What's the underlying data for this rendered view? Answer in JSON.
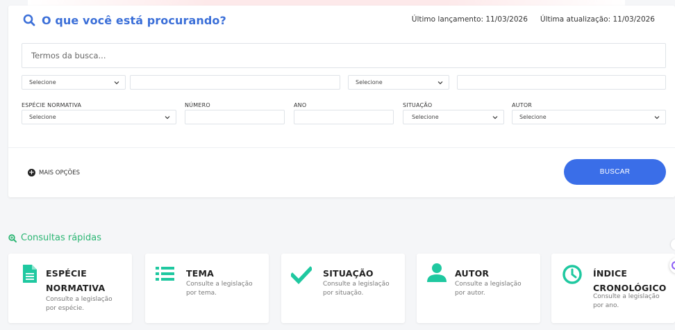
{
  "search": {
    "heading": "O que você está procurando?",
    "last_release": "Último lançamento: 11/03/2026",
    "last_update": "Última atualização: 11/03/2026",
    "terms_placeholder": "Termos da busca...",
    "row1": {
      "select1": "Selecione",
      "input1": "",
      "select2": "Selecione",
      "input2": ""
    },
    "labels": {
      "especie": "ESPÉCIE NORMATIVA",
      "numero": "NÚMERO",
      "ano": "ANO",
      "situacao": "SITUAÇÃO",
      "autor": "AUTOR"
    },
    "row2": {
      "especie_value": "Selecione",
      "numero_value": "",
      "ano_value": "",
      "situacao_value": "Selecione",
      "autor_value": "Selecione"
    },
    "more_options": "MAIS OPÇÕES",
    "search_button": "BUSCAR"
  },
  "quick": {
    "title": "Consultas rápidas",
    "accent_color": "#2bb673",
    "cards": [
      {
        "icon": "document-icon",
        "title_line1": "ESPÉCIE",
        "title_line2": "NORMATIVA",
        "desc_line1": "Consulte a legislação",
        "desc_line2": "por espécie."
      },
      {
        "icon": "list-icon",
        "title_line1": "TEMA",
        "title_line2": "",
        "desc_line1": "Consulte a legislação",
        "desc_line2": "por tema."
      },
      {
        "icon": "check-icon",
        "title_line1": "SITUAÇÃO",
        "title_line2": "",
        "desc_line1": "Consulte a legislação",
        "desc_line2": "por situação."
      },
      {
        "icon": "user-icon",
        "title_line1": "AUTOR",
        "title_line2": "",
        "desc_line1": "Consulte a legislação",
        "desc_line2": "por autor."
      },
      {
        "icon": "clock-icon",
        "title_line1": "ÍNDICE",
        "title_line2": "CRONOLÓGICO",
        "desc_line1": "Consulte a legislação",
        "desc_line2": "por ano."
      }
    ]
  },
  "colors": {
    "primary_blue": "#3a6ee8",
    "heading_blue": "#3b6fd8",
    "teal": "#1fc8a0"
  }
}
